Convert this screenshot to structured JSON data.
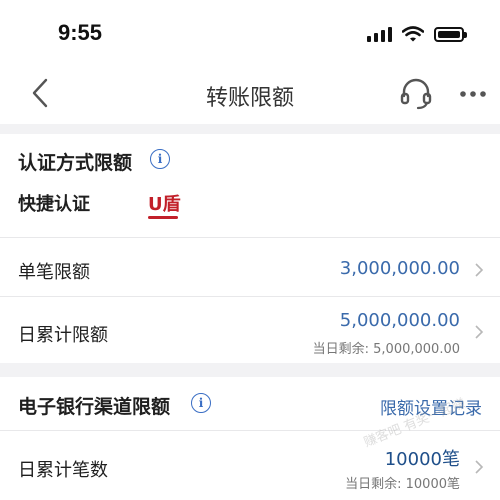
{
  "status_bar": {
    "time": "9:55"
  },
  "nav": {
    "title": "转账限额"
  },
  "auth_section": {
    "title": "认证方式限额",
    "info_glyph": "i",
    "tabs": [
      {
        "label": "快捷认证",
        "selected": false
      },
      {
        "label": "U盾",
        "selected": true
      }
    ],
    "rows": [
      {
        "label": "单笔限额",
        "value": "3,000,000.00"
      },
      {
        "label": "日累计限额",
        "value": "5,000,000.00",
        "sub": "当日剩余: 5,000,000.00"
      }
    ]
  },
  "channel_section": {
    "title": "电子银行渠道限额",
    "info_glyph": "i",
    "link_label": "限额设置记录",
    "rows": [
      {
        "label": "日累计笔数",
        "value": "10000笔",
        "sub": "当日剩余: 10000笔"
      }
    ]
  },
  "colors": {
    "accent_blue": "#3a6aab",
    "accent_red": "#c2202a",
    "background": "#f2f2f4"
  },
  "watermark": "赚客吧 有奖一起赚"
}
